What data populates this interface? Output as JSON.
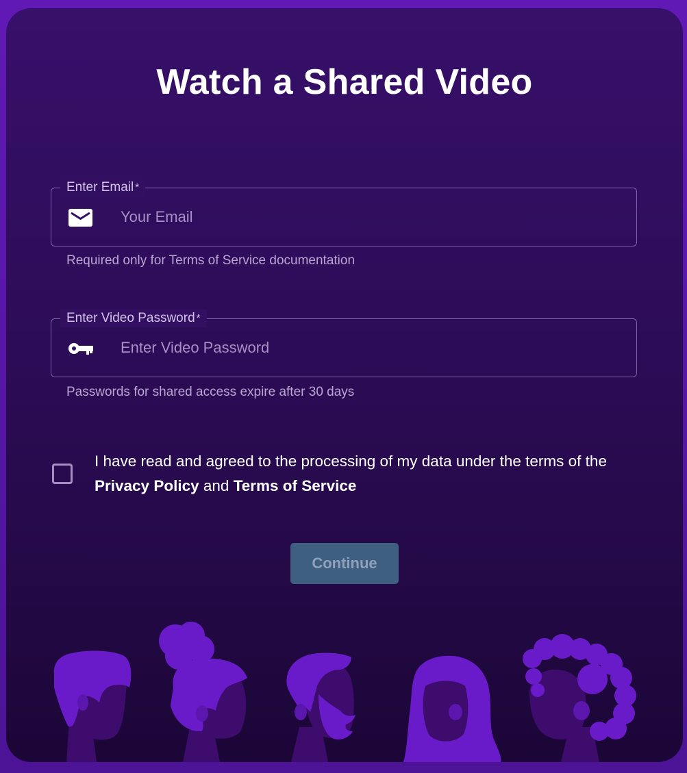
{
  "page": {
    "title": "Watch a Shared Video"
  },
  "email_field": {
    "label": "Enter Email",
    "required_mark": "*",
    "placeholder": "Your Email",
    "icon": "mail-icon",
    "helper": "Required only for Terms of Service documentation"
  },
  "password_field": {
    "label": "Enter Video Password",
    "required_mark": "*",
    "placeholder": "Enter Video Password",
    "icon": "key-icon",
    "helper": "Passwords for shared access expire after 30 days"
  },
  "consent": {
    "checked": false,
    "text_before": "I have read and agreed to the processing of my data under the terms of the",
    "privacy_link": "Privacy Policy",
    "and": "and",
    "terms_link": "Terms of Service"
  },
  "actions": {
    "continue_label": "Continue"
  },
  "colors": {
    "background": "#5f17b4",
    "card_top": "#37106a",
    "card_bottom": "#1b0637",
    "accent_purple": "#6a1bc9",
    "shadow_purple": "#3e0c6c",
    "button_disabled": "#3e5f80",
    "button_text_disabled": "#8fa0bb"
  }
}
